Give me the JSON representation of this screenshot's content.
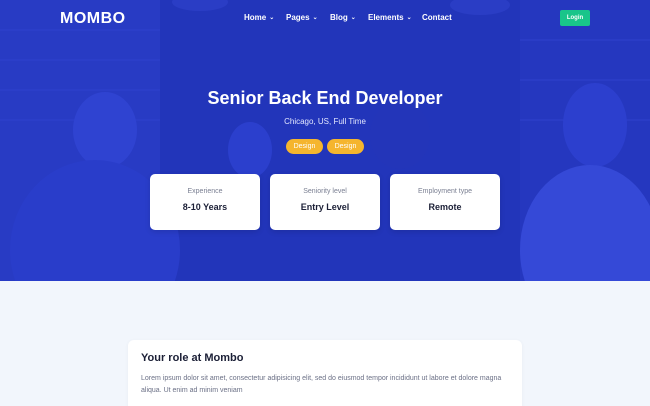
{
  "brand": {
    "logo": "MOMBO"
  },
  "nav": {
    "items": [
      {
        "label": "Home",
        "has_dropdown": true
      },
      {
        "label": "Pages",
        "has_dropdown": true
      },
      {
        "label": "Blog",
        "has_dropdown": true
      },
      {
        "label": "Elements",
        "has_dropdown": true
      },
      {
        "label": "Contact",
        "has_dropdown": false
      }
    ],
    "login_label": "Login"
  },
  "hero": {
    "title": "Senior Back End Developer",
    "subtitle": "Chicago, US, Full Time",
    "tags": [
      "Design",
      "Design"
    ]
  },
  "info_cards": [
    {
      "label": "Experience",
      "value": "8-10 Years"
    },
    {
      "label": "Seniority level",
      "value": "Entry Level"
    },
    {
      "label": "Employment type",
      "value": "Remote"
    }
  ],
  "role": {
    "title": "Your role at Mombo",
    "text": "Lorem ipsum dolor sit amet, consectetur adipisicing elit, sed do eiusmod tempor incididunt ut labore et dolore magna aliqua. Ut enim ad minim veniam"
  },
  "colors": {
    "hero_overlay": "#2a3fd0",
    "accent_green": "#19c58a",
    "tag_yellow": "#f5b52e",
    "page_bg": "#f2f6fc"
  }
}
